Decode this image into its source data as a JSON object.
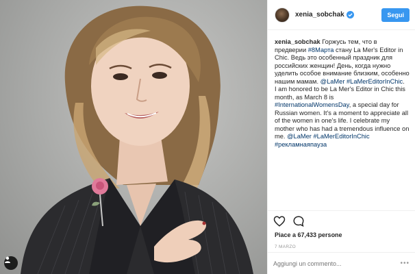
{
  "post": {
    "username": "xenia_sobchak",
    "follow_label": "Segui",
    "caption_user": "xenia_sobchak",
    "caption": [
      {
        "t": "Горжусь тем, что в предверии ",
        "link": false
      },
      {
        "t": "#8Марта",
        "link": true
      },
      {
        "t": " стану La Mer's Editor in Chic. Ведь это особенный праздник для российских женщин! День, когда нужно уделить особое внимание близким, особенно нашим мамам. ",
        "link": false
      },
      {
        "t": "@LaMer",
        "link": true
      },
      {
        "t": " ",
        "link": false
      },
      {
        "t": "#LaMerEditorInChic",
        "link": true
      },
      {
        "t": ".",
        "link": false
      },
      {
        "t": "\nI am honored to be La Mer's Editor in Chic this month, as March 8 is ",
        "link": false
      },
      {
        "t": "#InternationalWomensDay",
        "link": true
      },
      {
        "t": ", a special day for Russian women. It's a moment to appreciate all of the women in one's life. I celebrate my mother who has had a tremendous influence on me. ",
        "link": false
      },
      {
        "t": "@LaMer",
        "link": true
      },
      {
        "t": " ",
        "link": false
      },
      {
        "t": "#LaMerEditorInChic",
        "link": true
      },
      {
        "t": " ",
        "link": false
      },
      {
        "t": "#рекламнаяпауза",
        "link": true
      }
    ],
    "likes_text": "Piace a 67,433 persone",
    "date": "7 MARZO",
    "comment_placeholder": "Aggiungi un commento...",
    "more_label": "•••",
    "icons": {
      "like": "heart-icon",
      "comment": "speech-bubble-icon",
      "verified": "verified-badge-icon",
      "tag": "user-tag-icon"
    },
    "colors": {
      "accent": "#3897f0",
      "link": "#003569"
    }
  }
}
